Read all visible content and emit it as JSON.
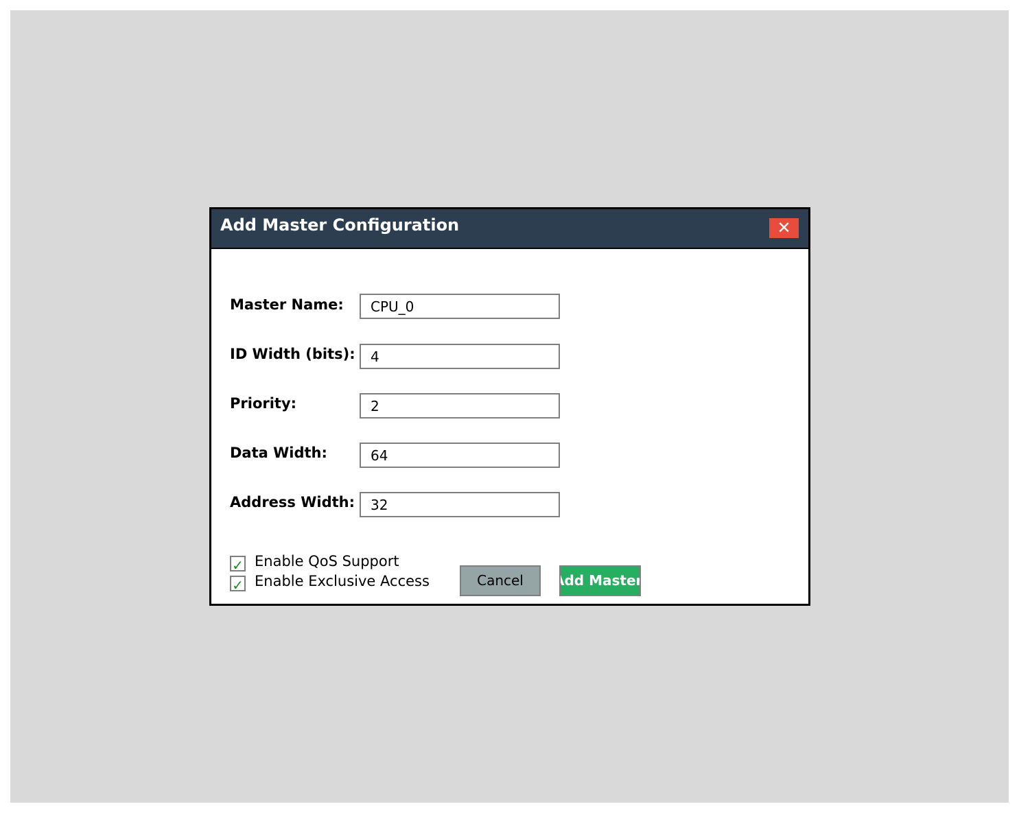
{
  "dialog": {
    "title": "Add Master Configuration",
    "close_symbol": "✕",
    "close_icon": "close-icon",
    "title_bar_color": "#2c3e50",
    "close_color": "#e74c3c"
  },
  "fields": [
    {
      "label": "Master Name:",
      "value": "CPU_0"
    },
    {
      "label": "ID Width (bits):",
      "value": "4"
    },
    {
      "label": "Priority:",
      "value": "2"
    },
    {
      "label": "Data Width:",
      "value": "64"
    },
    {
      "label": "Address Width:",
      "value": "32"
    }
  ],
  "checkboxes": [
    {
      "label": "Enable QoS Support",
      "checked": true,
      "mark": "✓"
    },
    {
      "label": "Enable Exclusive Access",
      "checked": true,
      "mark": "✓"
    }
  ],
  "buttons": {
    "cancel_label": "Cancel",
    "add_label": "Add Master",
    "add_color": "#27ae60",
    "cancel_color": "#95a5a6"
  }
}
